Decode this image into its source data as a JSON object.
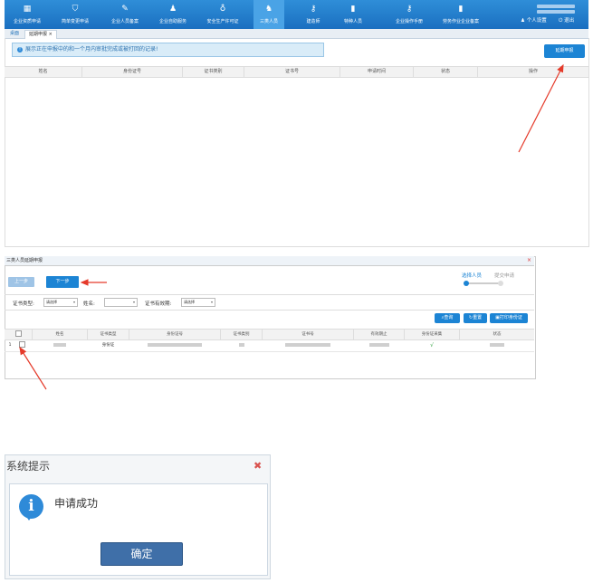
{
  "nav": {
    "items": [
      {
        "label": "企业资质申请",
        "icon": "grid-icon"
      },
      {
        "label": "简单变更申请",
        "icon": "shield-icon"
      },
      {
        "label": "企业人员备案",
        "icon": "user-edit-icon"
      },
      {
        "label": "企业自助服务",
        "icon": "user-icon"
      },
      {
        "label": "安全生产许可证",
        "icon": "award-icon"
      },
      {
        "label": "三类人员",
        "icon": "users-icon"
      },
      {
        "label": "建造师",
        "icon": "user-key-icon"
      },
      {
        "label": "特种人员",
        "icon": "book-icon"
      },
      {
        "label": "企业操作手册",
        "icon": "user-key-icon"
      },
      {
        "label": "劳务作业企业备案",
        "icon": "book-icon"
      }
    ],
    "personal_settings": "个人设置",
    "logout": "退出"
  },
  "tabs": {
    "home": "桌面",
    "extension": "延期申报",
    "close": "×"
  },
  "panel1": {
    "notice": "展示正在申报中的和一个月内审批完成或被打回的记录!",
    "extend_button": "延期申报",
    "columns": [
      "姓名",
      "身份证号",
      "证书类别",
      "证书号",
      "申请时间",
      "状态",
      "操作"
    ]
  },
  "panel2": {
    "title": "三类人员延期申报",
    "close": "×",
    "prev_button": "上一步",
    "next_button": "下一步",
    "steps": [
      "选择人员",
      "提交申请"
    ],
    "filters": {
      "cert_type_label": "证书类型:",
      "cert_type_value": "请选择",
      "name_label": "姓名:",
      "name_value": "",
      "validity_label": "证书有效期:",
      "validity_value": "请选择"
    },
    "actions": {
      "search": "查询",
      "reset": "重置",
      "print": "打印身份证"
    },
    "columns": [
      "",
      "姓名",
      "证书类型",
      "身份证号",
      "证书类别",
      "证书号",
      "有效期止",
      "身份证采集",
      "状态"
    ],
    "rows": [
      {
        "index": "1",
        "cert_type": "身份证",
        "id_collected": "√"
      }
    ]
  },
  "dialog": {
    "title": "系统提示",
    "close": "✖",
    "message": "申请成功",
    "ok_button": "确定"
  },
  "colors": {
    "primary": "#1c84d4",
    "nav_bg": "#2f8ed8",
    "arrow": "#e53a2a",
    "ok_button": "#3f6fa8"
  }
}
